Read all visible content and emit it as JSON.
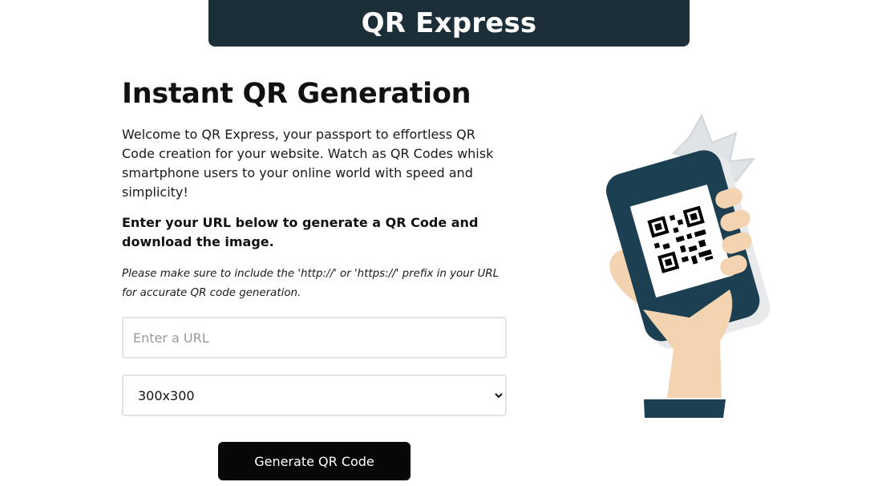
{
  "header": {
    "brand": "QR Express"
  },
  "main": {
    "headline": "Instant QR Generation",
    "intro": "Welcome to QR Express, your passport to effortless QR Code creation for your website. Watch as QR Codes whisk smartphone users to your online world with speed and simplicity!",
    "instruction": "Enter your URL below to generate a QR Code and download the image.",
    "note": "Please make sure to include the 'http://' or 'https://' prefix in your URL for accurate QR code generation.",
    "url_input": {
      "placeholder": "Enter a URL",
      "value": ""
    },
    "size_select": {
      "selected": "300x300"
    },
    "generate_label": "Generate QR Code"
  },
  "illustration": {
    "name": "hand-holding-phone-with-qr-code",
    "colors": {
      "phone": "#1c3f52",
      "skin": "#f3d3b0",
      "burst": "#dfe3e6",
      "accent": "#3d9cc6"
    }
  }
}
